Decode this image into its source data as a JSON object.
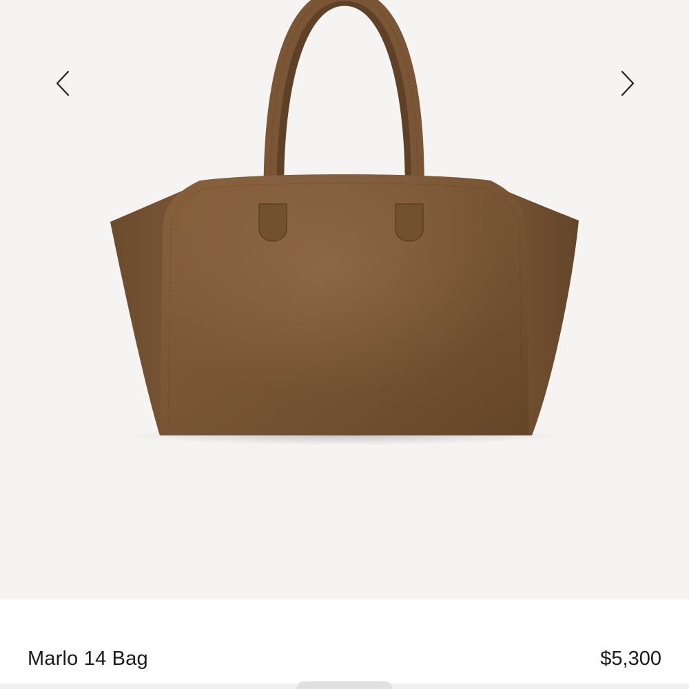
{
  "gallery": {
    "image_alt": "Marlo 14 Bag",
    "prev_icon": "chevron-left-icon",
    "next_icon": "chevron-right-icon",
    "background_color": "#f6f4f2",
    "bag_color": "#7a5636"
  },
  "product": {
    "name": "Marlo 14 Bag",
    "price": "$5,300"
  }
}
